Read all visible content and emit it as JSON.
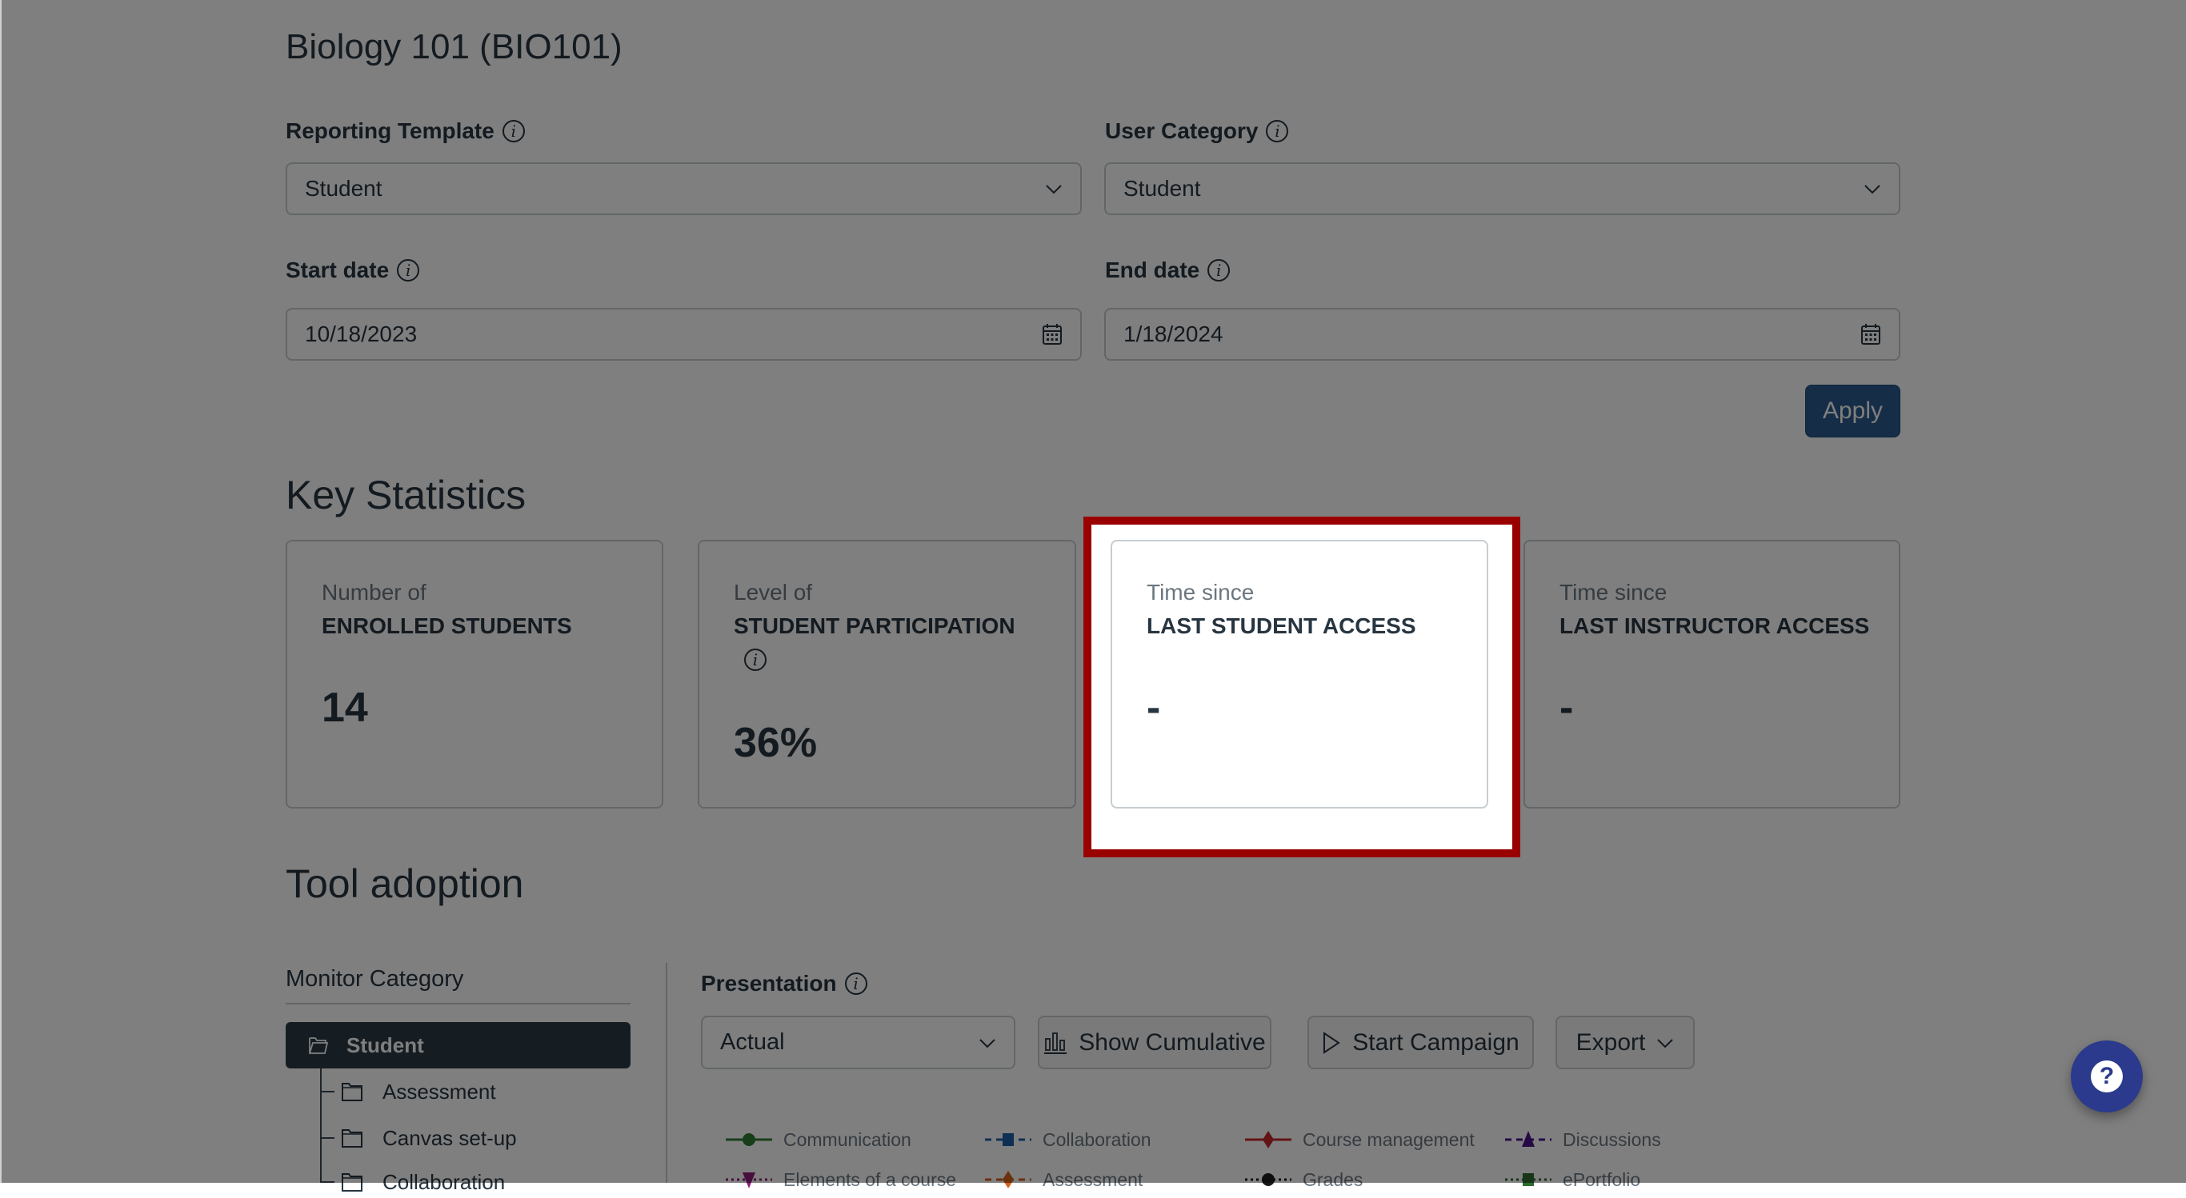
{
  "course": {
    "title": "Biology 101 (BIO101)"
  },
  "filters": {
    "reporting_template": {
      "label": "Reporting Template",
      "value": "Student"
    },
    "user_category": {
      "label": "User Category",
      "value": "Student"
    },
    "start_date": {
      "label": "Start date",
      "value": "10/18/2023"
    },
    "end_date": {
      "label": "End date",
      "value": "1/18/2024"
    },
    "apply_label": "Apply"
  },
  "key_statistics": {
    "heading": "Key Statistics",
    "cards": [
      {
        "pre": "Number of",
        "main": "ENROLLED STUDENTS",
        "value": "14",
        "has_info": false
      },
      {
        "pre": "Level of",
        "main": "STUDENT PARTICIPATION",
        "value": "36%",
        "has_info": true
      },
      {
        "pre": "Time since",
        "main": "LAST STUDENT ACCESS",
        "value": "-",
        "highlighted": true
      },
      {
        "pre": "Time since",
        "main": "LAST INSTRUCTOR ACCESS",
        "value": "-"
      }
    ]
  },
  "tool_adoption": {
    "heading": "Tool adoption",
    "monitor_category": {
      "label": "Monitor Category",
      "selected": "Student",
      "children": [
        "Assessment",
        "Canvas set-up",
        "Collaboration"
      ]
    },
    "presentation": {
      "label": "Presentation",
      "value": "Actual"
    },
    "buttons": {
      "show_cumulative": "Show Cumulative",
      "start_campaign": "Start Campaign",
      "export": "Export"
    },
    "legend": [
      {
        "label": "Communication",
        "color": "#2e7d32",
        "marker": "circle",
        "dash": "solid"
      },
      {
        "label": "Collaboration",
        "color": "#1f5fa8",
        "marker": "square",
        "dash": "dashed"
      },
      {
        "label": "Course management",
        "color": "#c62828",
        "marker": "diamond",
        "dash": "solid"
      },
      {
        "label": "Discussions",
        "color": "#4a148c",
        "marker": "triangle-up",
        "dash": "dashed"
      },
      {
        "label": "Elements of a course",
        "color": "#8e1f7a",
        "marker": "triangle-down",
        "dash": "dotted"
      },
      {
        "label": "Assessment",
        "color": "#d4621a",
        "marker": "diamond",
        "dash": "dashed"
      },
      {
        "label": "Grades",
        "color": "#1a1a1a",
        "marker": "circle",
        "dash": "dotted"
      },
      {
        "label": "ePortfolio",
        "color": "#2e6b2e",
        "marker": "square",
        "dash": "dotted"
      }
    ]
  },
  "colors": {
    "overlay": "#808080",
    "highlight_frame": "#990000",
    "primary_button": "#2d5b8e",
    "help_button": "#2b3a8c",
    "selected_tree_item": "#2d3b45"
  },
  "help": {
    "icon": "question-icon"
  }
}
